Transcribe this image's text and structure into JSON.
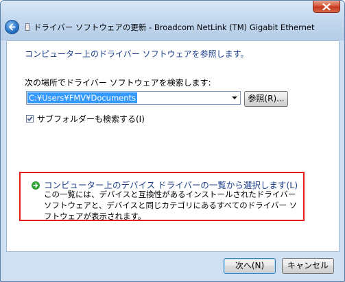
{
  "window": {
    "title": "ドライバー ソフトウェアの更新 - Broadcom NetLink (TM) Gigabit Ethernet"
  },
  "icons": {
    "close": "close-icon",
    "back": "back-arrow-icon",
    "device": "device-icon",
    "option": "green-arrow-icon",
    "combo": "chevron-down-icon",
    "check": "checkmark-icon"
  },
  "content": {
    "heading": "コンピューター上のドライバー ソフトウェアを参照します。",
    "search_label": "次の場所でドライバー ソフトウェアを検索します:",
    "path_value": "C:¥Users¥FMV¥Documents",
    "browse_label": "参照(R)...",
    "subfolder_label": "サブフォルダーも検索する(I)",
    "subfolder_checked": true,
    "option_title": "コンピューター上のデバイス ドライバーの一覧から選択します(L)",
    "option_desc": "この一覧には、デバイスと互換性があるインストールされたドライバー ソフトウェアと、デバイスと同じカテゴリにあるすべてのドライバー ソフトウェアが表示されます。"
  },
  "footer": {
    "next_label": "次へ(N)",
    "cancel_label": "キャンセル"
  },
  "colors": {
    "link_blue": "#1a3e8c",
    "highlight_red": "#e31b1b",
    "selection_blue": "#3399ff"
  }
}
